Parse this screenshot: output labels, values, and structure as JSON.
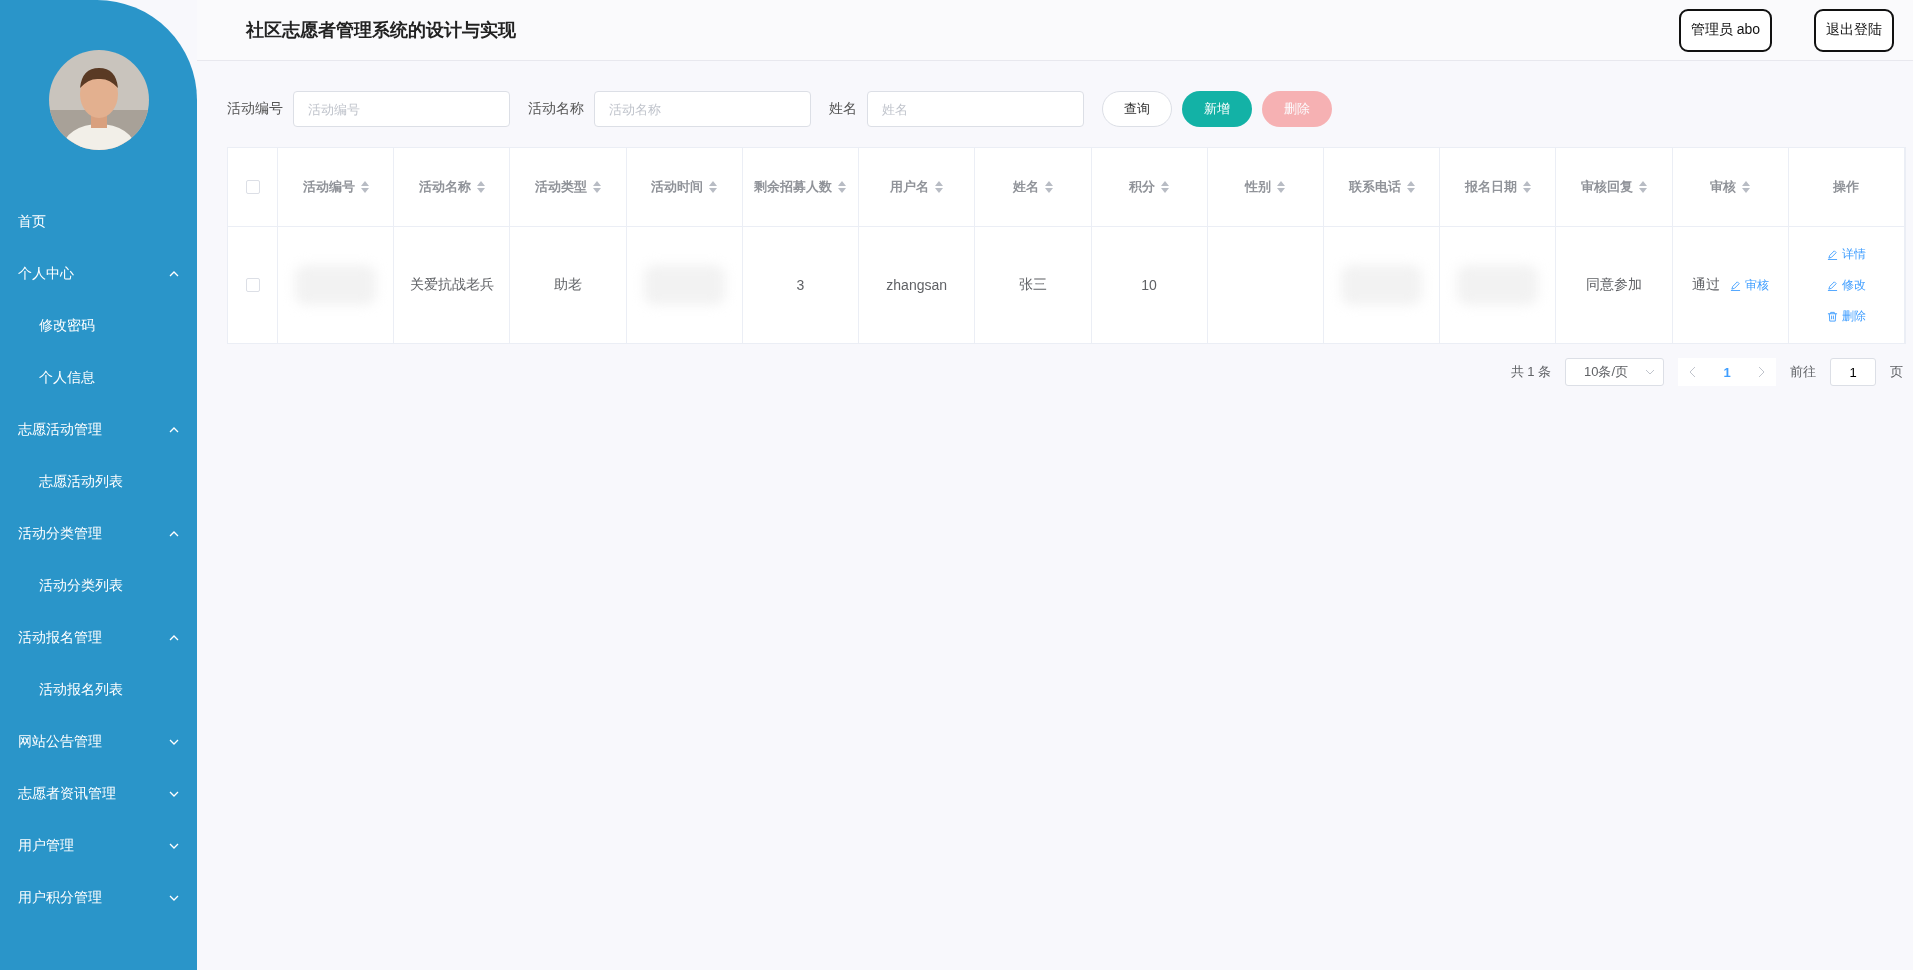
{
  "app_title": "社区志愿者管理系统的设计与实现",
  "header_buttons": [
    {
      "label": "管理员 abo"
    },
    {
      "label": "退出登陆"
    }
  ],
  "sidebar": {
    "items": [
      {
        "label": "首页"
      },
      {
        "label": "个人中心",
        "expanded": true,
        "children": [
          {
            "label": "修改密码"
          },
          {
            "label": "个人信息"
          }
        ]
      },
      {
        "label": "志愿活动管理",
        "expanded": true,
        "children": [
          {
            "label": "志愿活动列表"
          }
        ]
      },
      {
        "label": "活动分类管理",
        "expanded": true,
        "children": [
          {
            "label": "活动分类列表"
          }
        ]
      },
      {
        "label": "活动报名管理",
        "expanded": true,
        "children": [
          {
            "label": "活动报名列表"
          }
        ]
      },
      {
        "label": "网站公告管理",
        "expanded": false
      },
      {
        "label": "志愿者资讯管理",
        "expanded": false
      },
      {
        "label": "用户管理",
        "expanded": false
      },
      {
        "label": "用户积分管理",
        "expanded": false
      }
    ]
  },
  "search": {
    "fields": [
      {
        "label": "活动编号",
        "placeholder": "活动编号"
      },
      {
        "label": "活动名称",
        "placeholder": "活动名称"
      },
      {
        "label": "姓名",
        "placeholder": "姓名"
      }
    ],
    "buttons": [
      {
        "label": "查询",
        "kind": "default"
      },
      {
        "label": "新增",
        "kind": "primary"
      },
      {
        "label": "删除",
        "kind": "danger",
        "disabled": true
      }
    ]
  },
  "table": {
    "all_checked": false,
    "columns": [
      {
        "label": "活动编号",
        "sortable": true
      },
      {
        "label": "活动名称",
        "sortable": true
      },
      {
        "label": "活动类型",
        "sortable": true
      },
      {
        "label": "活动时间",
        "sortable": true
      },
      {
        "label": "剩余招募人数",
        "sortable": true
      },
      {
        "label": "用户名",
        "sortable": true
      },
      {
        "label": "姓名",
        "sortable": true
      },
      {
        "label": "积分",
        "sortable": true
      },
      {
        "label": "性别",
        "sortable": true
      },
      {
        "label": "联系电话",
        "sortable": true
      },
      {
        "label": "报名日期",
        "sortable": true
      },
      {
        "label": "审核回复",
        "sortable": true
      },
      {
        "label": "审核",
        "sortable": true
      },
      {
        "label": "操作",
        "sortable": false
      }
    ],
    "rows": [
      {
        "checked": false,
        "cells": [
          {
            "kind": "blurred"
          },
          {
            "kind": "text",
            "text": "关爱抗战老兵"
          },
          {
            "kind": "text",
            "text": "助老"
          },
          {
            "kind": "blurred"
          },
          {
            "kind": "text",
            "text": "3"
          },
          {
            "kind": "text",
            "text": "zhangsan"
          },
          {
            "kind": "text",
            "text": "张三"
          },
          {
            "kind": "text",
            "text": "10"
          },
          {
            "kind": "empty"
          },
          {
            "kind": "blurred"
          },
          {
            "kind": "blurred"
          },
          {
            "kind": "text",
            "text": "同意参加"
          },
          {
            "kind": "audit",
            "text": "通过",
            "action": "审核"
          },
          {
            "kind": "actions",
            "actions": [
              {
                "label": "详情"
              },
              {
                "label": "修改"
              },
              {
                "label": "删除"
              }
            ]
          }
        ]
      }
    ]
  },
  "pagination": {
    "total": "共 1 条",
    "page_size": "10条/页",
    "pages": [
      {
        "label": "1",
        "selected": true
      }
    ],
    "goto_label": "前往",
    "goto_value": "1",
    "goto_suffix": "页"
  }
}
